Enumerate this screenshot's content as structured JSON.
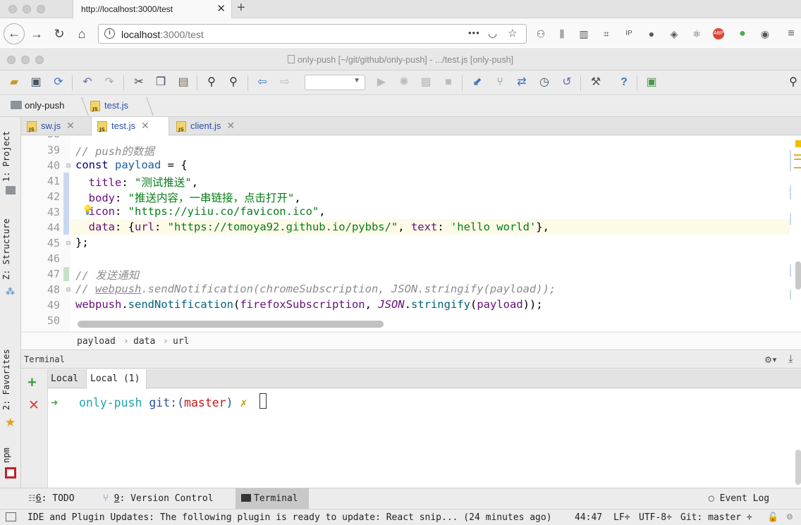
{
  "browser": {
    "tab_title": "http://localhost:3000/test",
    "url_host": "localhost",
    "url_rest": ":3000/test",
    "more_icon": "•••"
  },
  "ide": {
    "window_title": "only-push [~/git/github/only-push] - .../test.js [only-push]",
    "breadcrumb": {
      "project": "only-push",
      "file": "test.js"
    },
    "editor_tabs": [
      {
        "label": "sw.js",
        "active": false
      },
      {
        "label": "test.js",
        "active": true
      },
      {
        "label": "client.js",
        "active": false
      }
    ],
    "side_tabs": {
      "project": "1: Project",
      "structure": "Z: Structure",
      "favorites": "2: Favorites",
      "npm": "npm"
    },
    "lines": {
      "l39": "39",
      "l40": "40",
      "l41": "41",
      "l42": "42",
      "l43": "43",
      "l44": "44",
      "l45": "45",
      "l46": "46",
      "l47": "47",
      "l48": "48",
      "l49": "49",
      "l50": "50"
    },
    "code": {
      "c39": "// push的数据",
      "c40_kw": "const",
      "c40_var": " payload",
      "c40_rest": " = {",
      "c41_prop": "title",
      "c41_str": "\"测试推送\"",
      "c42_prop": "body",
      "c42_str": "\"推送内容，一串链接，点击打开\"",
      "c43_prop": "icon",
      "c43_str": "\"https://yiiu.co/favicon.ico\"",
      "c44_prop": "data",
      "c44_url_prop": "url",
      "c44_url_str": "\"https://tomoya92.github.io/pybbs/\"",
      "c44_text_prop": "text",
      "c44_text_str": "'hello world'",
      "c45": "};",
      "c47": "// 发送通知",
      "c48_a": "// ",
      "c48_b": "webpush",
      "c48_c": ".sendNotification(chromeSubscription, JSON.stringify(payload));",
      "c49_obj": "webpush",
      "c49_dot": ".",
      "c49_fn": "sendNotification",
      "c49_open": "(",
      "c49_arg1": "firefoxSubscription",
      "c49_sep": ", ",
      "c49_json": "JSON",
      "c49_dot2": ".",
      "c49_fn2": "stringify",
      "c49_open2": "(",
      "c49_arg2": "payload",
      "c49_close": "));"
    },
    "code_breadcrumb": [
      "payload",
      "data",
      "url"
    ],
    "terminal": {
      "header": "Terminal",
      "tabs": [
        "Local",
        "Local (1)"
      ],
      "prompt_arrow": "➜",
      "prompt_dir": "only-push",
      "prompt_git": "git:(",
      "prompt_branch": "master",
      "prompt_git_close": ")",
      "prompt_dirty": "✗"
    },
    "bottom_tools": {
      "todo_num": "6",
      "todo_label": ": TODO",
      "vc_num": "9",
      "vc_label": ": Version Control",
      "terminal": "Terminal",
      "event_log": "Event Log"
    },
    "status": {
      "message": "IDE and Plugin Updates: The following plugin is ready to update: React snip... (24 minutes ago)",
      "position": "44:47",
      "line_sep": "LF÷",
      "encoding": "UTF-8÷",
      "git": "Git: master ÷"
    }
  },
  "colors": {
    "accent_blue": "#2b4fa8",
    "string_green": "#067d17",
    "prompt_cyan": "#1fa2b5",
    "branch_red": "#c41a16",
    "add_green": "#3fa33f",
    "remove_red": "#d63b3b"
  }
}
